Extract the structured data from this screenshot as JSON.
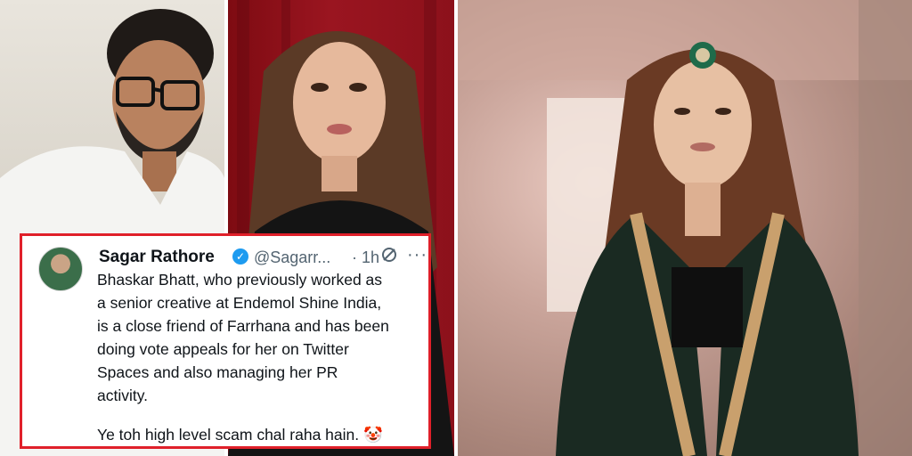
{
  "tweet": {
    "author_name": "Sagar Rathore",
    "handle": "@Sagarr...",
    "time": "· 1h",
    "paragraph_1": "Bhaskar Bhatt, who previously worked as\na senior creative at Endemol Shine India,\nis a close friend of Farrhana and has been\ndoing vote appeals for her on Twitter\nSpaces and also managing her PR\nactivity.",
    "paragraph_2": "Ye toh high level scam chal raha hain. 🤡",
    "more_glyph": "···",
    "verified_glyph": "✓"
  },
  "colors": {
    "frame_red": "#e0202a",
    "verified_blue": "#1d9bf0",
    "curtain_red": "#8c111b"
  },
  "icons": [
    "verified-badge-icon",
    "grok-icon",
    "more-options-icon"
  ]
}
